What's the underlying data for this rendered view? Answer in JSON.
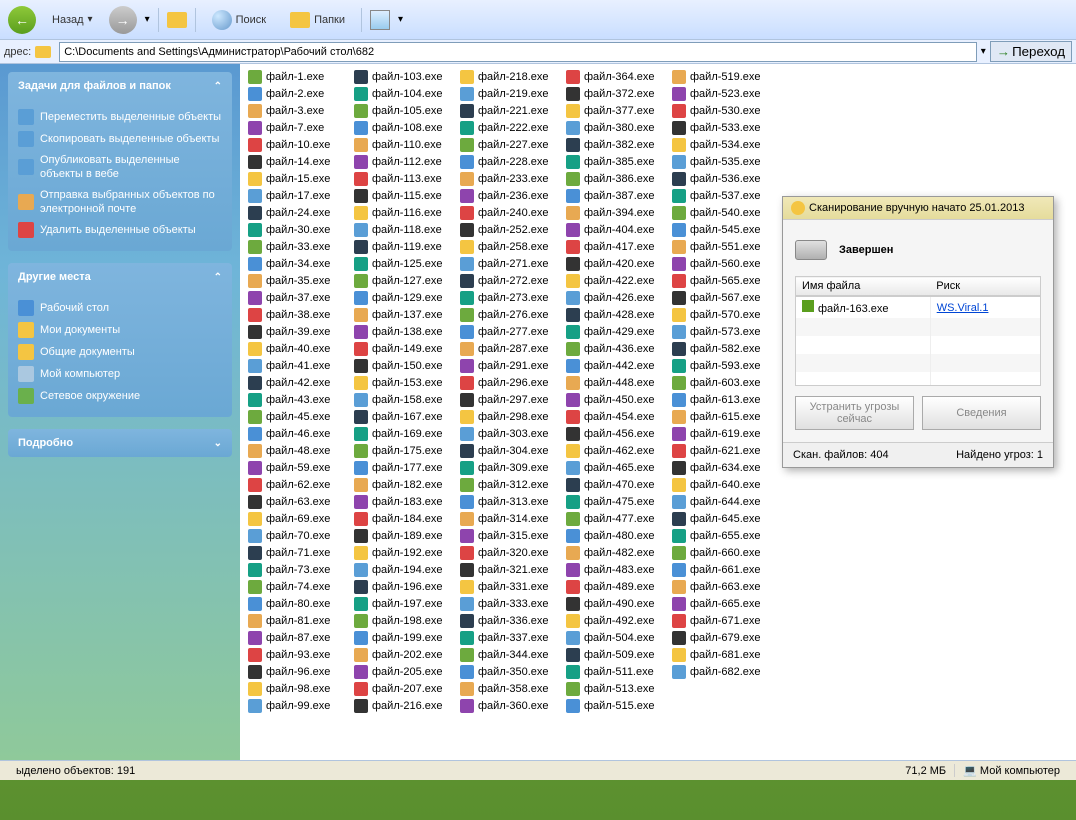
{
  "toolbar": {
    "back_label": "Назад",
    "search_label": "Поиск",
    "folders_label": "Папки"
  },
  "address": {
    "label": "дрес:",
    "path": "C:\\Documents and Settings\\Администратор\\Рабочий стол\\682",
    "go_label": "Переход"
  },
  "sidebar": {
    "tasks": {
      "title": "Задачи для файлов и папок",
      "items": [
        "Переместить выделенные объекты",
        "Скопировать выделенные объекты",
        "Опубликовать выделенные объекты в вебе",
        "Отправка выбранных объектов по электронной почте",
        "Удалить выделенные объекты"
      ]
    },
    "places": {
      "title": "Другие места",
      "items": [
        "Рабочий стол",
        "Мои документы",
        "Общие документы",
        "Мой компьютер",
        "Сетевое окружение"
      ]
    },
    "details": {
      "title": "Подробно"
    }
  },
  "files": [
    "файл-1.exe",
    "файл-2.exe",
    "файл-3.exe",
    "файл-7.exe",
    "файл-10.exe",
    "файл-14.exe",
    "файл-15.exe",
    "файл-17.exe",
    "файл-24.exe",
    "файл-30.exe",
    "файл-33.exe",
    "файл-34.exe",
    "файл-35.exe",
    "файл-37.exe",
    "файл-38.exe",
    "файл-39.exe",
    "файл-40.exe",
    "файл-41.exe",
    "файл-42.exe",
    "файл-43.exe",
    "файл-45.exe",
    "файл-46.exe",
    "файл-48.exe",
    "файл-59.exe",
    "файл-62.exe",
    "файл-63.exe",
    "файл-69.exe",
    "файл-70.exe",
    "файл-71.exe",
    "файл-73.exe",
    "файл-74.exe",
    "файл-80.exe",
    "файл-81.exe",
    "файл-87.exe",
    "файл-93.exe",
    "файл-96.exe",
    "файл-98.exe",
    "файл-99.exe",
    "файл-103.exe",
    "файл-104.exe",
    "файл-105.exe",
    "файл-108.exe",
    "файл-110.exe",
    "файл-112.exe",
    "файл-113.exe",
    "файл-115.exe",
    "файл-116.exe",
    "файл-118.exe",
    "файл-119.exe",
    "файл-125.exe",
    "файл-127.exe",
    "файл-129.exe",
    "файл-137.exe",
    "файл-138.exe",
    "файл-149.exe",
    "файл-150.exe",
    "файл-153.exe",
    "файл-158.exe",
    "файл-167.exe",
    "файл-169.exe",
    "файл-175.exe",
    "файл-177.exe",
    "файл-182.exe",
    "файл-183.exe",
    "файл-184.exe",
    "файл-189.exe",
    "файл-192.exe",
    "файл-194.exe",
    "файл-196.exe",
    "файл-197.exe",
    "файл-198.exe",
    "файл-199.exe",
    "файл-202.exe",
    "файл-205.exe",
    "файл-207.exe",
    "файл-216.exe",
    "файл-218.exe",
    "файл-219.exe",
    "файл-221.exe",
    "файл-222.exe",
    "файл-227.exe",
    "файл-228.exe",
    "файл-233.exe",
    "файл-236.exe",
    "файл-240.exe",
    "файл-252.exe",
    "файл-258.exe",
    "файл-271.exe",
    "файл-272.exe",
    "файл-273.exe",
    "файл-276.exe",
    "файл-277.exe",
    "файл-287.exe",
    "файл-291.exe",
    "файл-296.exe",
    "файл-297.exe",
    "файл-298.exe",
    "файл-303.exe",
    "файл-304.exe",
    "файл-309.exe",
    "файл-312.exe",
    "файл-313.exe",
    "файл-314.exe",
    "файл-315.exe",
    "файл-320.exe",
    "файл-321.exe",
    "файл-331.exe",
    "файл-333.exe",
    "файл-336.exe",
    "файл-337.exe",
    "файл-344.exe",
    "файл-350.exe",
    "файл-358.exe",
    "файл-360.exe",
    "файл-364.exe",
    "файл-372.exe",
    "файл-377.exe",
    "файл-380.exe",
    "файл-382.exe",
    "файл-385.exe",
    "файл-386.exe",
    "файл-387.exe",
    "файл-394.exe",
    "файл-404.exe",
    "файл-417.exe",
    "файл-420.exe",
    "файл-422.exe",
    "файл-426.exe",
    "файл-428.exe",
    "файл-429.exe",
    "файл-436.exe",
    "файл-442.exe",
    "файл-448.exe",
    "файл-450.exe",
    "файл-454.exe",
    "файл-456.exe",
    "файл-462.exe",
    "файл-465.exe",
    "файл-470.exe",
    "файл-475.exe",
    "файл-477.exe",
    "файл-480.exe",
    "файл-482.exe",
    "файл-483.exe",
    "файл-489.exe",
    "файл-490.exe",
    "файл-492.exe",
    "файл-504.exe",
    "файл-509.exe",
    "файл-511.exe",
    "файл-513.exe",
    "файл-515.exe",
    "файл-519.exe",
    "файл-523.exe",
    "файл-530.exe",
    "файл-533.exe",
    "файл-534.exe",
    "файл-535.exe",
    "файл-536.exe",
    "файл-537.exe",
    "файл-540.exe",
    "файл-545.exe",
    "файл-551.exe",
    "файл-560.exe",
    "файл-565.exe",
    "файл-567.exe",
    "файл-570.exe",
    "файл-573.exe",
    "файл-582.exe",
    "файл-593.exe",
    "файл-603.exe",
    "файл-613.exe",
    "файл-615.exe",
    "файл-619.exe",
    "файл-621.exe",
    "файл-634.exe",
    "файл-640.exe",
    "файл-644.exe",
    "файл-645.exe",
    "файл-655.exe",
    "файл-660.exe",
    "файл-661.exe",
    "файл-663.exe",
    "файл-665.exe",
    "файл-671.exe",
    "файл-679.exe",
    "файл-681.exe",
    "файл-682.exe"
  ],
  "statusbar": {
    "selected": "ыделено объектов: 191",
    "size": "71,2 МБ",
    "location": "Мой компьютер"
  },
  "scan": {
    "title": "Сканирование вручную начато 25.01.2013",
    "status": "Завершен",
    "col_filename": "Имя файла",
    "col_risk": "Риск",
    "row_file": "файл-163.exe",
    "row_risk": "WS.Viral.1",
    "btn_fix": "Устранить угрозы сейчас",
    "btn_details": "Сведения",
    "footer_scanned": "Скан. файлов: 404",
    "footer_found": "Найдено угроз: 1"
  }
}
